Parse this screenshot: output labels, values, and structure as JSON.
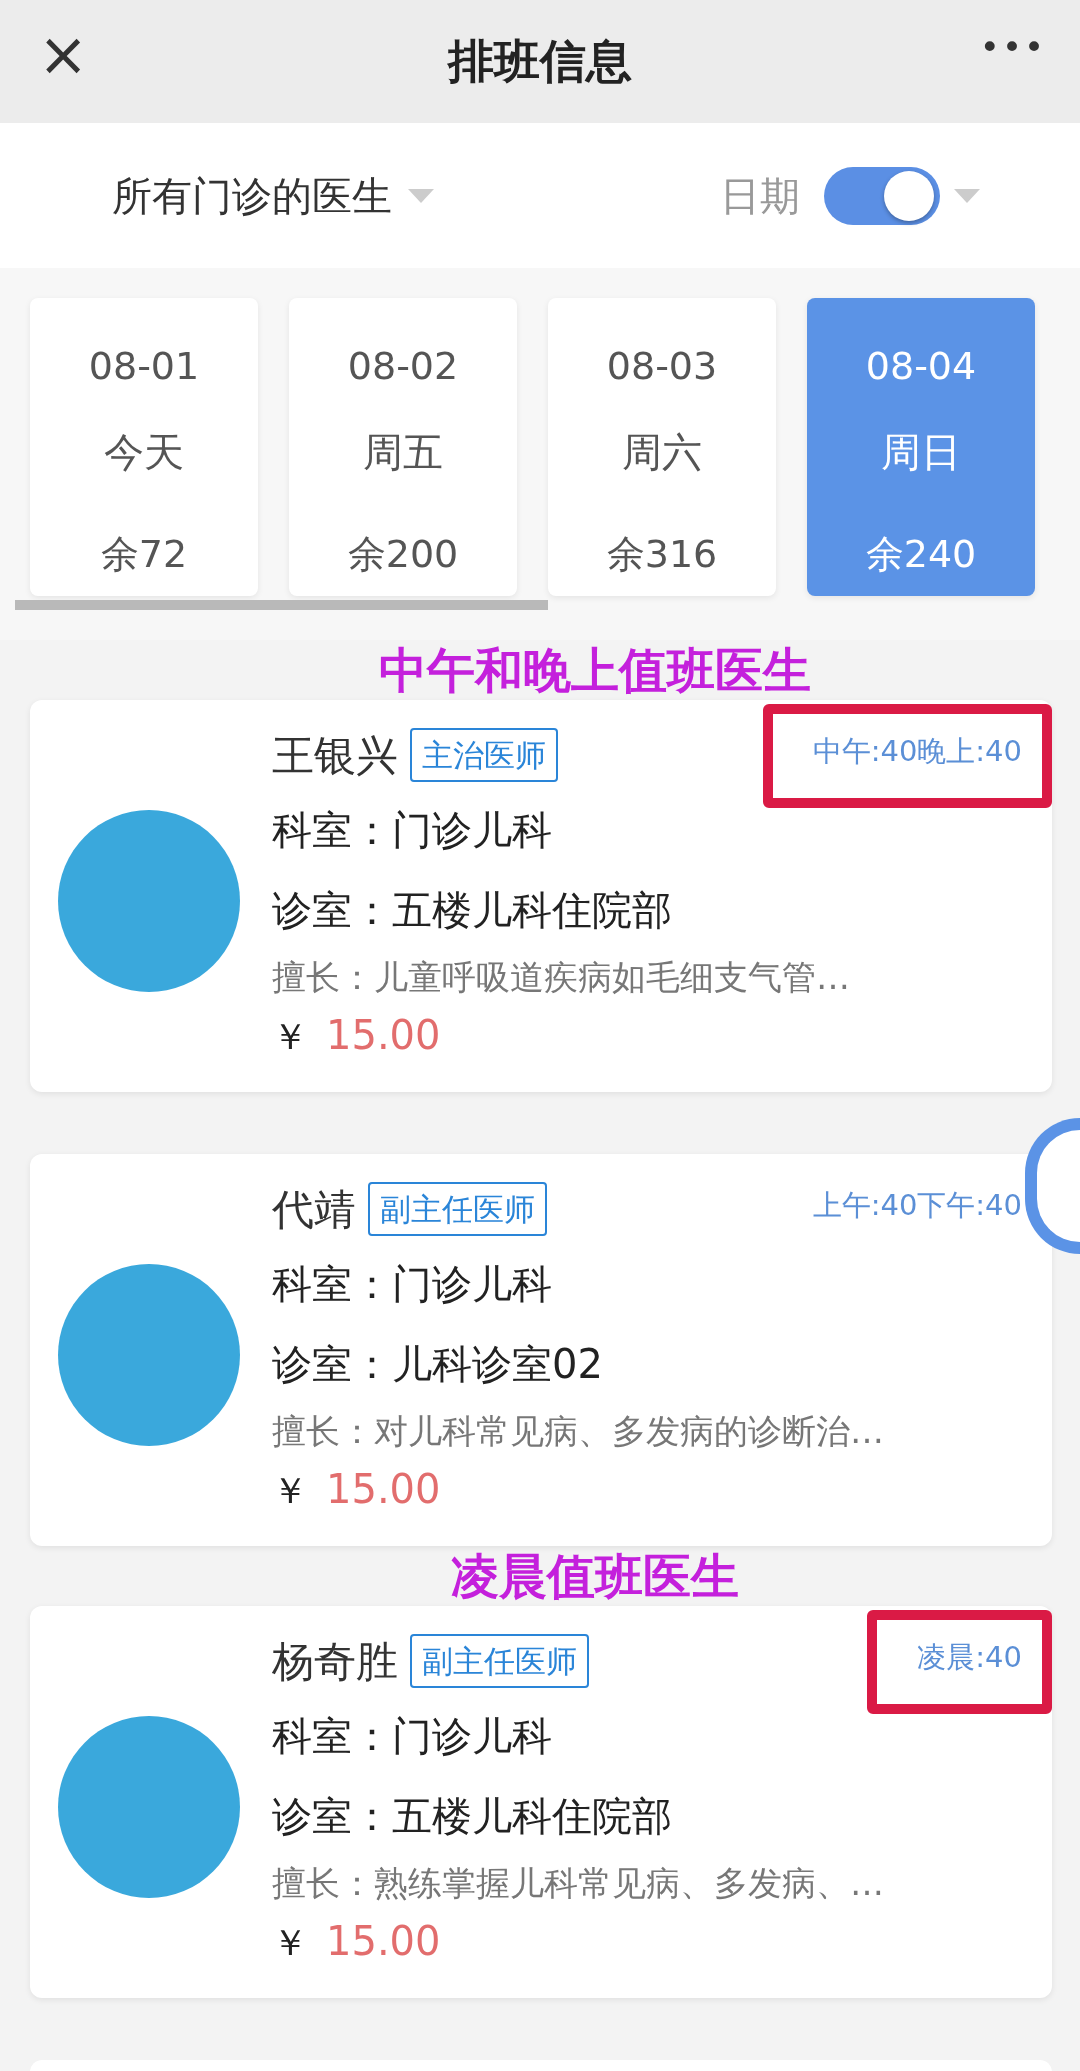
{
  "header": {
    "close": "×",
    "title": "排班信息",
    "more": "•••"
  },
  "filter": {
    "department": "所有门诊的医生",
    "date_label": "日期",
    "date_toggle": {
      "on": true
    }
  },
  "dates": [
    {
      "date": "08-01",
      "day": "今天",
      "remaining": "余72",
      "selected": false
    },
    {
      "date": "08-02",
      "day": "周五",
      "remaining": "余200",
      "selected": false
    },
    {
      "date": "08-03",
      "day": "周六",
      "remaining": "余316",
      "selected": false
    },
    {
      "date": "08-04",
      "day": "周日",
      "remaining": "余240",
      "selected": true
    }
  ],
  "list": [
    {
      "kind": "annotation",
      "text": "中午和晚上值班医生"
    },
    {
      "kind": "doctor",
      "name": "王银兴",
      "title": "主治医师",
      "slots": "中午:40晚上:40",
      "highlighted": true,
      "department": "科室：门诊儿科",
      "room": "诊室：五楼儿科住院部",
      "expertise": "擅长：儿童呼吸道疾病如毛细支气管…",
      "currency": "￥",
      "price": "15.00"
    },
    {
      "kind": "doctor",
      "name": "代靖",
      "title": "副主任医师",
      "slots": "上午:40下午:40",
      "highlighted": false,
      "department": "科室：门诊儿科",
      "room": "诊室：儿科诊室02",
      "expertise": "擅长：对儿科常见病、多发病的诊断治…",
      "currency": "￥",
      "price": "15.00"
    },
    {
      "kind": "annotation",
      "text": "凌晨值班医生"
    },
    {
      "kind": "doctor",
      "name": "杨奇胜",
      "title": "副主任医师",
      "slots": "凌晨:40",
      "highlighted": true,
      "department": "科室：门诊儿科",
      "room": "诊室：五楼儿科住院部",
      "expertise": "擅长：熟练掌握儿科常见病、多发病、…",
      "currency": "￥",
      "price": "15.00"
    }
  ]
}
